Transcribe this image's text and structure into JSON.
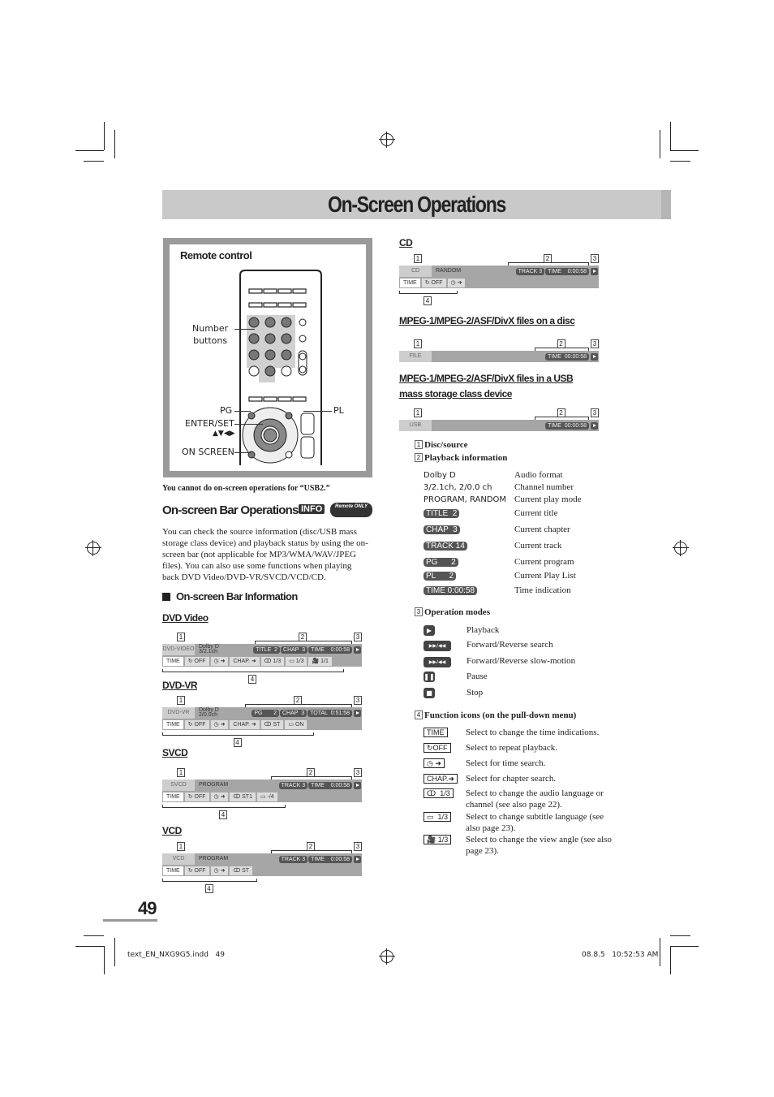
{
  "page": {
    "title": "On-Screen Operations",
    "page_number": "49",
    "footer_file": "text_EN_NXG9G5.indd   49",
    "footer_date": "08.8.5   10:52:53 AM"
  },
  "remote": {
    "heading": "Remote control",
    "number_buttons": "Number\nbuttons",
    "pg": "PG",
    "pl": "PL",
    "enter_set": "ENTER/SET",
    "arrows": "▲▼◀▶",
    "on_screen": "ON SCREEN",
    "note": "You cannot do on-screen operations for “USB2.”"
  },
  "left": {
    "section_title": "On-screen Bar Operations",
    "info_badge": "INFO",
    "remote_only_badge": "Remote ONLY",
    "intro": "You can check the source information (disc/USB mass storage class device) and playback status by using the on-screen bar (not applicable for MP3/WMA/WAV/JPEG files). You can also use some functions when playing back DVD Video/DVD-VR/SVCD/VCD/CD.",
    "subheading": "On-screen Bar Information"
  },
  "bars": [
    {
      "label": "DVD Video",
      "source": "DVD-VIDEO",
      "info": [
        "Dolby D",
        "3/2.1ch"
      ],
      "pills": [
        "TITLE  2",
        "CHAP  3",
        "TIME    0:00:58"
      ],
      "funcs": [
        "TIME",
        "↻ OFF",
        "◷ ➜",
        "CHAP. ➜",
        "ↀ 1/3",
        "▭ 1/3",
        "🎥 1/1"
      ],
      "callouts": [
        "1",
        "2",
        "3",
        "4"
      ]
    },
    {
      "label": "DVD-VR",
      "source": "DVD-VR",
      "info": [
        "Dolby D",
        "2/0.0ch"
      ],
      "pills": [
        "PG       2",
        "CHAP  3",
        "TOTAL  0:51:58"
      ],
      "funcs": [
        "TIME",
        "↻ OFF",
        "◷ ➜",
        "CHAP. ➜",
        "ↀ ST",
        "▭ ON"
      ],
      "callouts": [
        "1",
        "2",
        "3",
        "4"
      ]
    },
    {
      "label": "SVCD",
      "source": "SVCD",
      "info": [
        "PROGRAM"
      ],
      "pills": [
        "TRACK 3",
        "TIME    0:00:58"
      ],
      "funcs": [
        "TIME",
        "↻ OFF",
        "◷ ➜",
        "ↀ ST1",
        "▭ -/4"
      ],
      "callouts": [
        "1",
        "2",
        "3",
        "4"
      ]
    },
    {
      "label": "VCD",
      "source": "VCD",
      "info": [
        "PROGRAM"
      ],
      "pills": [
        "TRACK 3",
        "TIME    0:00:58"
      ],
      "funcs": [
        "TIME",
        "↻ OFF",
        "◷ ➜",
        "ↀ ST"
      ],
      "callouts": [
        "1",
        "2",
        "3",
        "4"
      ]
    },
    {
      "label": "CD",
      "source": "CD",
      "info": [
        "RANDOM"
      ],
      "pills": [
        "TRACK 3",
        "TIME    0:00:58"
      ],
      "funcs": [
        "TIME",
        "↻ OFF",
        "◷ ➜"
      ],
      "callouts": [
        "1",
        "2",
        "3",
        "4"
      ]
    },
    {
      "label": "MPEG-1/MPEG-2/ASF/DivX files on a disc",
      "source": "FILE",
      "info": [],
      "pills": [
        "TIME  00:00:58"
      ],
      "funcs": [],
      "callouts": [
        "1",
        "2",
        "3"
      ]
    },
    {
      "label": "MPEG-1/MPEG-2/ASF/DivX files in a USB mass storage class device",
      "source": "USB",
      "info": [],
      "pills": [
        "TIME  00:00:58"
      ],
      "funcs": [],
      "callouts": [
        "1",
        "2",
        "3"
      ]
    }
  ],
  "legend": {
    "disc_source": {
      "num": "1",
      "label": "Disc/source"
    },
    "playback": {
      "num": "2",
      "label": "Playback information",
      "items": [
        {
          "term": "Dolby D",
          "desc": "Audio format"
        },
        {
          "term": "3/2.1ch, 2/0.0 ch",
          "desc": "Channel number"
        },
        {
          "term": "PROGRAM, RANDOM",
          "desc": "Current play mode"
        },
        {
          "pill": "TITLE  2",
          "desc": "Current title"
        },
        {
          "pill": "CHAP  3",
          "desc": "Current chapter"
        },
        {
          "pill": "TRACK 14",
          "desc": "Current track"
        },
        {
          "pill": "PG      2",
          "desc": "Current program"
        },
        {
          "pill": "PL      2",
          "desc": "Current Play List"
        },
        {
          "pill": "TIME 0:00:58",
          "desc": "Time indication"
        }
      ]
    },
    "operation": {
      "num": "3",
      "label": "Operation modes",
      "items": [
        {
          "icon": "play-icon",
          "glyph": "▶",
          "desc": "Playback"
        },
        {
          "icon": "forward-reverse-search-icon",
          "glyph": "▶▶/◀◀",
          "desc": "Forward/Reverse search"
        },
        {
          "icon": "forward-reverse-slow-icon",
          "glyph": "▶▶/◀◀",
          "desc": "Forward/Reverse slow-motion"
        },
        {
          "icon": "pause-icon",
          "glyph": "❚❚",
          "desc": "Pause"
        },
        {
          "icon": "stop-icon",
          "glyph": "■",
          "desc": "Stop"
        }
      ]
    },
    "functions": {
      "num": "4",
      "label": "Function icons (on the pull-down menu)",
      "items": [
        {
          "icon": "TIME",
          "desc": "Select to change the time indications."
        },
        {
          "icon": "↻OFF",
          "desc": "Select to repeat playback."
        },
        {
          "icon": "◷ ➜",
          "desc": "Select for time search."
        },
        {
          "icon": "CHAP.➜",
          "desc": "Select for chapter search."
        },
        {
          "icon": "ↀ  1/3",
          "desc": "Select to change the audio language or channel (see also page 22)."
        },
        {
          "icon": "▭  1/3",
          "desc": "Select to change subtitle language (see also page 23)."
        },
        {
          "icon": "🎥 1/3",
          "desc": "Select to change the view angle (see also page 23)."
        }
      ]
    }
  }
}
